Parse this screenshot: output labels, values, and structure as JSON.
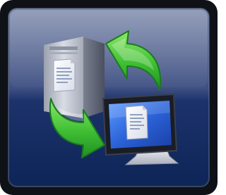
{
  "tile": {
    "icon": "sync-files-icon",
    "components": [
      "server-tower-icon",
      "document-icon",
      "monitor-icon",
      "arrow-icon"
    ]
  },
  "colors": {
    "frame_dark": "#0e1116",
    "frame_highlight": "#7e8aa6",
    "bg_top": "#5c6c92",
    "bg_mid": "#34467a",
    "bg_bottom": "#10285a",
    "arrow_green": "#46c93a",
    "arrow_dark": "#1f8d22",
    "server_light": "#c8ccd6",
    "server_dark": "#6e7482",
    "monitor_bezel": "#1a1d25",
    "screen_blue": "#2f6fe6"
  }
}
